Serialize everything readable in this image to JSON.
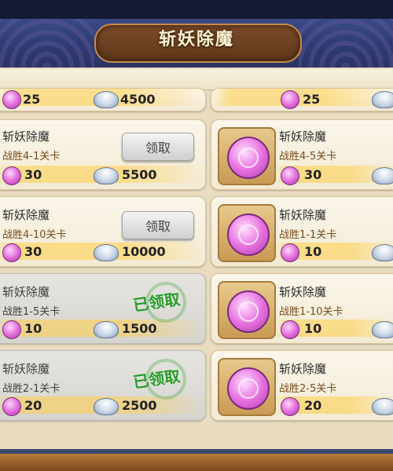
{
  "header": {
    "title": "斩妖除魔"
  },
  "partial_row": {
    "left_gem": "25",
    "left_silver": "4500",
    "right_gem": "25"
  },
  "left_cards": [
    {
      "name": "斩妖除魔",
      "cond": "战胜4-1关卡",
      "gem": "30",
      "silver": "5500",
      "state": "claim",
      "btn": "领取"
    },
    {
      "name": "斩妖除魔",
      "cond": "战胜4-10关卡",
      "gem": "30",
      "silver": "10000",
      "state": "claim",
      "btn": "领取"
    },
    {
      "name": "斩妖除魔",
      "cond": "战胜1-5关卡",
      "gem": "10",
      "silver": "1500",
      "state": "claimed",
      "stamp": "已领取"
    },
    {
      "name": "斩妖除魔",
      "cond": "战胜2-1关卡",
      "gem": "20",
      "silver": "2500",
      "state": "claimed",
      "stamp": "已领取"
    }
  ],
  "right_cards": [
    {
      "name": "斩妖除魔",
      "cond": "战胜4-5关卡",
      "gem": "30"
    },
    {
      "name": "斩妖除魔",
      "cond": "战胜1-1关卡",
      "gem": "10"
    },
    {
      "name": "斩妖除魔",
      "cond": "战胜1-10关卡",
      "gem": "10"
    },
    {
      "name": "斩妖除魔",
      "cond": "战胜2-5关卡",
      "gem": "20"
    }
  ],
  "icons": {
    "gem": "pink-gem-icon",
    "silver": "silver-ingot-icon",
    "frame": "jade-token-icon"
  }
}
